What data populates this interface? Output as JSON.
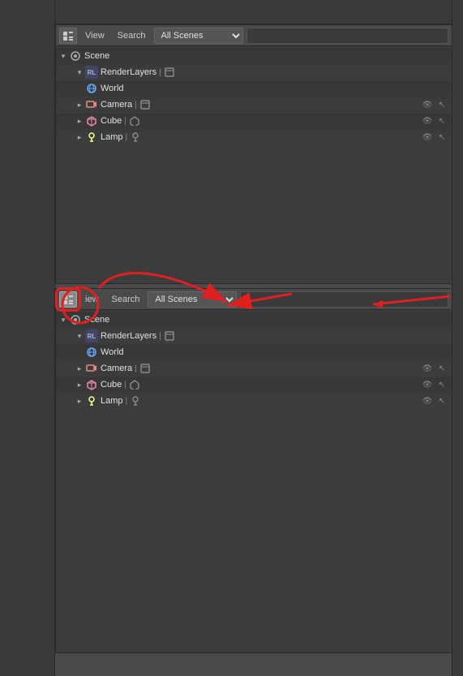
{
  "header": {
    "view_label": "View",
    "search_label": "Search",
    "all_scenes_label": "All Scenes",
    "search_placeholder": ""
  },
  "top_panel": {
    "title": "Scene",
    "items": [
      {
        "type": "scene",
        "name": "Scene",
        "depth": 0,
        "expandable": true,
        "icon": "scene"
      },
      {
        "type": "renderlayer",
        "name": "RenderLayers",
        "depth": 1,
        "expandable": true,
        "icon": "renderlayer",
        "has_action": true
      },
      {
        "type": "world",
        "name": "World",
        "depth": 1,
        "icon": "world"
      },
      {
        "type": "camera",
        "name": "Camera",
        "depth": 1,
        "icon": "camera",
        "has_action": true,
        "has_right_icons": true
      },
      {
        "type": "cube",
        "name": "Cube",
        "depth": 1,
        "icon": "cube",
        "has_action": true,
        "has_right_icons": true
      },
      {
        "type": "lamp",
        "name": "Lamp",
        "depth": 1,
        "icon": "lamp",
        "has_action": true,
        "has_right_icons": true
      }
    ]
  },
  "bottom_panel": {
    "title": "Scene",
    "items": [
      {
        "type": "scene",
        "name": "Scene",
        "depth": 0,
        "expandable": true,
        "icon": "scene"
      },
      {
        "type": "renderlayer",
        "name": "RenderLayers",
        "depth": 1,
        "expandable": true,
        "icon": "renderlayer",
        "has_action": true
      },
      {
        "type": "world",
        "name": "World",
        "depth": 1,
        "icon": "world"
      },
      {
        "type": "camera",
        "name": "Camera",
        "depth": 1,
        "icon": "camera",
        "has_action": true,
        "has_right_icons": true
      },
      {
        "type": "cube",
        "name": "Cube",
        "depth": 1,
        "icon": "cube",
        "has_action": true,
        "has_right_icons": true
      },
      {
        "type": "lamp",
        "name": "Lamp",
        "depth": 1,
        "icon": "lamp",
        "has_action": true,
        "has_right_icons": true
      }
    ]
  },
  "icons": {
    "scene": "🎬",
    "renderlayer": "RL",
    "world": "🌐",
    "camera": "📷",
    "cube": "⬡",
    "lamp": "💡",
    "eye": "👁",
    "cursor": "↖",
    "render": "📷"
  }
}
